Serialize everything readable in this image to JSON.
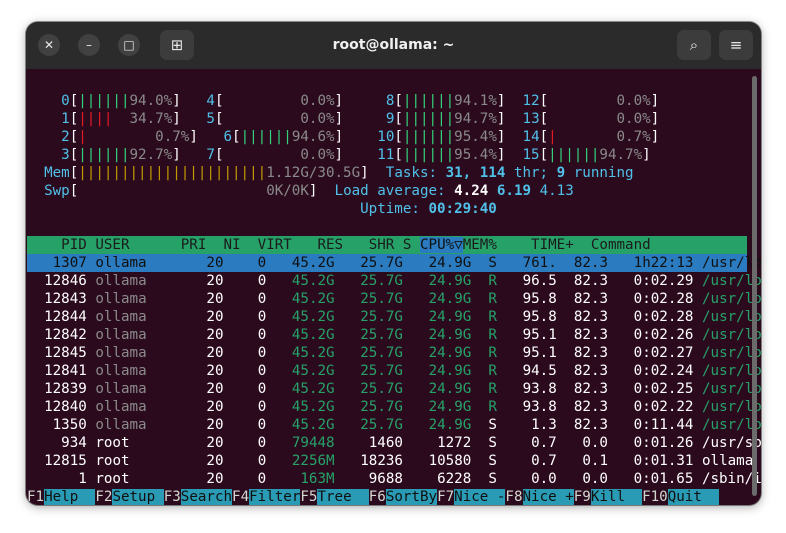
{
  "window": {
    "title": "root@ollama: ~"
  },
  "titlebar": {
    "close_glyph": "✕",
    "minimize_glyph": "–",
    "maximize_glyph": "□",
    "newtab_glyph": "⊞",
    "search_glyph": "⌕",
    "menu_glyph": "≡"
  },
  "cpu": {
    "c0": {
      "num": "0",
      "bar": "||||||",
      "pct": "94.0%"
    },
    "c1": {
      "num": "1",
      "bar": "||||",
      "pct": "34.7%"
    },
    "c2": {
      "num": "2",
      "bar": "|",
      "pct": "0.7%"
    },
    "c3": {
      "num": "3",
      "bar": "||||||",
      "pct": "92.7%"
    },
    "c4": {
      "num": "4",
      "bar": "",
      "pct": "0.0%"
    },
    "c5": {
      "num": "5",
      "bar": "",
      "pct": "0.0%"
    },
    "c6": {
      "num": "6",
      "bar": "||||||",
      "pct": "94.6%"
    },
    "c7": {
      "num": "7",
      "bar": "",
      "pct": "0.0%"
    },
    "c8": {
      "num": "8",
      "bar": "||||||",
      "pct": "94.1%"
    },
    "c9": {
      "num": "9",
      "bar": "||||||",
      "pct": "94.7%"
    },
    "c10": {
      "num": "10",
      "bar": "||||||",
      "pct": "95.4%"
    },
    "c11": {
      "num": "11",
      "bar": "||||||",
      "pct": "95.4%"
    },
    "c12": {
      "num": "12",
      "bar": "",
      "pct": "0.0%"
    },
    "c13": {
      "num": "13",
      "bar": "",
      "pct": "0.0%"
    },
    "c14": {
      "num": "14",
      "bar": "|",
      "pct": "0.7%"
    },
    "c15": {
      "num": "15",
      "bar": "||||||",
      "pct": "94.7%"
    }
  },
  "mem": {
    "label": "Mem",
    "bar": "||||||||||||||||||||||",
    "value": "1.12G/30.5G"
  },
  "swp": {
    "label": "Swp",
    "value": "0K/0K"
  },
  "tasks": {
    "label": "Tasks:",
    "total": "31,",
    "threads": "114",
    "thr_label": "thr;",
    "running": "9",
    "running_label": "running"
  },
  "load": {
    "label": "Load average:",
    "l1": "4.24",
    "l5": "6.19",
    "l15": "4.13"
  },
  "uptime": {
    "label": "Uptime:",
    "value": "00:29:40"
  },
  "columns": {
    "pid": "PID",
    "user": "USER",
    "pri": "PRI",
    "ni": "NI",
    "virt": "VIRT",
    "res": "RES",
    "shr": "SHR",
    "s": "S",
    "cpu": "CPU%▽",
    "mem": "MEM%",
    "time": "TIME+",
    "cmd": "Command"
  },
  "rows": [
    {
      "pid": "1307",
      "user": "ollama",
      "pri": "20",
      "ni": "0",
      "virt": "45.2G",
      "res": "25.7G",
      "shr": "24.9G",
      "s": "S",
      "cpu": "761.",
      "mem": "82.3",
      "time": "1h22:13",
      "cmd": "/usr/local/bin/"
    },
    {
      "pid": "12846",
      "user": "ollama",
      "pri": "20",
      "ni": "0",
      "virt": "45.2G",
      "res": "25.7G",
      "shr": "24.9G",
      "s": "R",
      "cpu": "96.5",
      "mem": "82.3",
      "time": "0:02.29",
      "cmd": "/usr/local/bin/"
    },
    {
      "pid": "12843",
      "user": "ollama",
      "pri": "20",
      "ni": "0",
      "virt": "45.2G",
      "res": "25.7G",
      "shr": "24.9G",
      "s": "R",
      "cpu": "95.8",
      "mem": "82.3",
      "time": "0:02.28",
      "cmd": "/usr/local/bin/"
    },
    {
      "pid": "12844",
      "user": "ollama",
      "pri": "20",
      "ni": "0",
      "virt": "45.2G",
      "res": "25.7G",
      "shr": "24.9G",
      "s": "R",
      "cpu": "95.8",
      "mem": "82.3",
      "time": "0:02.28",
      "cmd": "/usr/local/bin/"
    },
    {
      "pid": "12842",
      "user": "ollama",
      "pri": "20",
      "ni": "0",
      "virt": "45.2G",
      "res": "25.7G",
      "shr": "24.9G",
      "s": "R",
      "cpu": "95.1",
      "mem": "82.3",
      "time": "0:02.26",
      "cmd": "/usr/local/bin/"
    },
    {
      "pid": "12845",
      "user": "ollama",
      "pri": "20",
      "ni": "0",
      "virt": "45.2G",
      "res": "25.7G",
      "shr": "24.9G",
      "s": "R",
      "cpu": "95.1",
      "mem": "82.3",
      "time": "0:02.27",
      "cmd": "/usr/local/bin/"
    },
    {
      "pid": "12841",
      "user": "ollama",
      "pri": "20",
      "ni": "0",
      "virt": "45.2G",
      "res": "25.7G",
      "shr": "24.9G",
      "s": "R",
      "cpu": "94.5",
      "mem": "82.3",
      "time": "0:02.24",
      "cmd": "/usr/local/bin/"
    },
    {
      "pid": "12839",
      "user": "ollama",
      "pri": "20",
      "ni": "0",
      "virt": "45.2G",
      "res": "25.7G",
      "shr": "24.9G",
      "s": "R",
      "cpu": "93.8",
      "mem": "82.3",
      "time": "0:02.25",
      "cmd": "/usr/local/bin/"
    },
    {
      "pid": "12840",
      "user": "ollama",
      "pri": "20",
      "ni": "0",
      "virt": "45.2G",
      "res": "25.7G",
      "shr": "24.9G",
      "s": "R",
      "cpu": "93.8",
      "mem": "82.3",
      "time": "0:02.22",
      "cmd": "/usr/local/bin/"
    },
    {
      "pid": "1350",
      "user": "ollama",
      "pri": "20",
      "ni": "0",
      "virt": "45.2G",
      "res": "25.7G",
      "shr": "24.9G",
      "s": "S",
      "cpu": "1.3",
      "mem": "82.3",
      "time": "0:11.44",
      "cmd": "/usr/local/bin/"
    },
    {
      "pid": "934",
      "user": "root",
      "pri": "20",
      "ni": "0",
      "virt": "79448",
      "res": "1460",
      "shr": "1272",
      "s": "S",
      "cpu": "0.7",
      "mem": "0.0",
      "time": "0:01.26",
      "cmd": "/usr/sbin/qemu-"
    },
    {
      "pid": "12815",
      "user": "root",
      "pri": "20",
      "ni": "0",
      "virt": "2256M",
      "res": "18236",
      "shr": "10580",
      "s": "S",
      "cpu": "0.7",
      "mem": "0.1",
      "time": "0:01.31",
      "cmd": "ollama run llam"
    },
    {
      "pid": "1",
      "user": "root",
      "pri": "20",
      "ni": "0",
      "virt": "163M",
      "res": "9688",
      "shr": "6228",
      "s": "S",
      "cpu": "0.0",
      "mem": "0.0",
      "time": "0:01.65",
      "cmd": "/sbin/init"
    }
  ],
  "fkeys": [
    {
      "key": "F1",
      "label": "Help  "
    },
    {
      "key": "F2",
      "label": "Setup "
    },
    {
      "key": "F3",
      "label": "Search"
    },
    {
      "key": "F4",
      "label": "Filter"
    },
    {
      "key": "F5",
      "label": "Tree  "
    },
    {
      "key": "F6",
      "label": "SortBy"
    },
    {
      "key": "F7",
      "label": "Nice -"
    },
    {
      "key": "F8",
      "label": "Nice +"
    },
    {
      "key": "F9",
      "label": "Kill  "
    },
    {
      "key": "F10",
      "label": "Quit  "
    }
  ],
  "colors": {
    "terminal_bg": "#2c0a1e",
    "header_green": "#26a269",
    "selection_blue": "#2a7bbf",
    "fkey_cyan": "#2a9bb5",
    "bar_green": "#33d17a",
    "bar_red": "#e01b24",
    "titlebar": "#2b2b2b"
  }
}
